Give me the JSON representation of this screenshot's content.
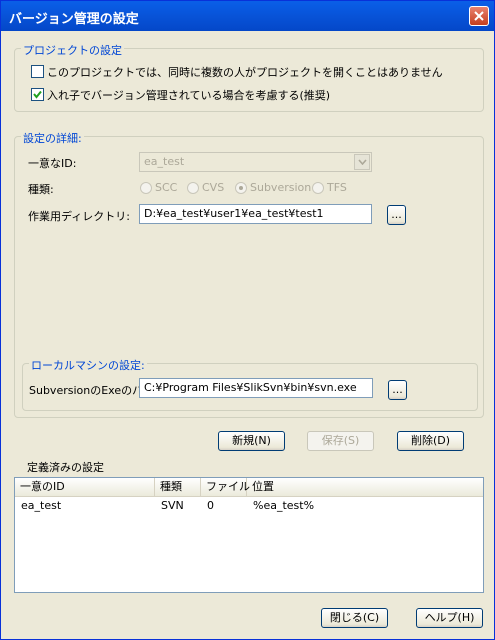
{
  "window": {
    "title": "バージョン管理の設定",
    "close_icon": "close-icon"
  },
  "project_settings": {
    "legend": "プロジェクトの設定",
    "checkbox1": {
      "label": "このプロジェクトでは、同時に複数の人がプロジェクトを開くことはありません",
      "checked": false
    },
    "checkbox2": {
      "label": "入れ子でバージョン管理されている場合を考慮する(推奨)",
      "checked": true
    }
  },
  "details": {
    "legend": "設定の詳細:",
    "unique_id_label": "一意なID:",
    "unique_id_value": "ea_test",
    "type_label": "種類:",
    "type_options": [
      "SCC",
      "CVS",
      "Subversion",
      "TFS"
    ],
    "type_selected": "Subversion",
    "workdir_label": "作業用ディレクトリ:",
    "workdir_value": "D:¥ea_test¥user1¥ea_test¥test1",
    "browse_label": "..."
  },
  "local": {
    "legend": "ローカルマシンの設定:",
    "exe_label": "SubversionのExeのパス",
    "exe_value": "C:¥Program Files¥SlikSvn¥bin¥svn.exe",
    "browse_label": "..."
  },
  "actions": {
    "new_label": "新規(N)",
    "save_label": "保存(S)",
    "delete_label": "削除(D)"
  },
  "defined": {
    "title": "定義済みの設定",
    "columns": [
      "一意のID",
      "種類",
      "ファイル",
      "位置"
    ],
    "rows": [
      {
        "id": "ea_test",
        "type": "SVN",
        "files": "0",
        "location": "%ea_test%"
      }
    ]
  },
  "footer": {
    "close_label": "閉じる(C)",
    "help_label": "ヘルプ(H)"
  },
  "colors": {
    "title_bar": "#0a5fe8",
    "group_legend": "#0046d5",
    "dialog_bg": "#ece9d8"
  }
}
